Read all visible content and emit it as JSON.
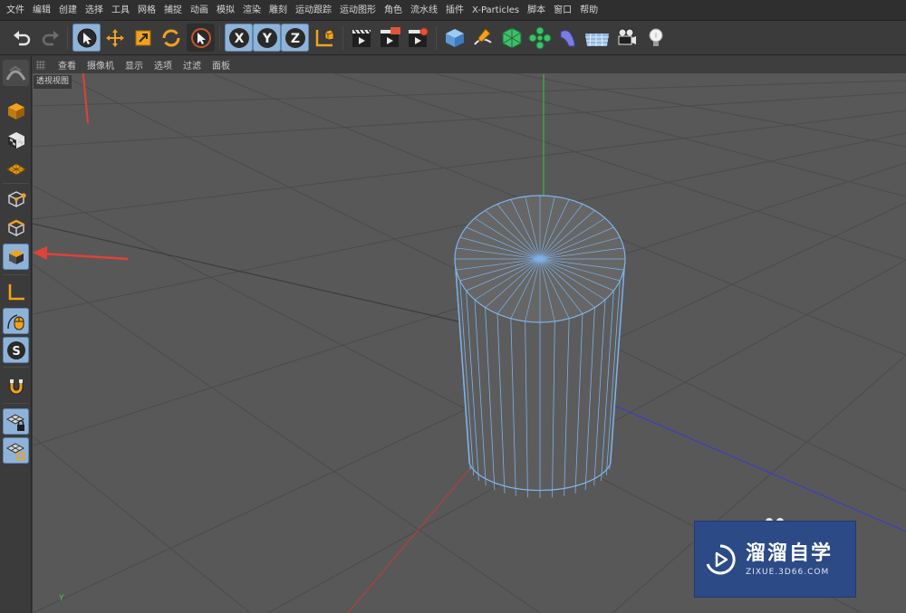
{
  "menubar": {
    "items": [
      "文件",
      "编辑",
      "创建",
      "选择",
      "工具",
      "网格",
      "捕捉",
      "动画",
      "模拟",
      "渲染",
      "雕刻",
      "运动跟踪",
      "运动图形",
      "角色",
      "流水线",
      "插件",
      "X-Particles",
      "脚本",
      "窗口",
      "帮助"
    ]
  },
  "toolbar": {
    "buttons": [
      "undo-icon",
      "redo-icon",
      "live-select-icon",
      "move-icon",
      "scale-icon",
      "rotate-icon",
      "recent-tool-icon",
      "x-axis-icon",
      "y-axis-icon",
      "z-axis-icon",
      "coordinate-system-icon",
      "render-view-icon",
      "render-picture-viewer-icon",
      "render-settings-icon",
      "cube-icon",
      "pen-spline-icon",
      "subdivision-icon",
      "mograph-cloner-icon",
      "deformer-icon",
      "floor-icon",
      "camera-icon",
      "light-icon"
    ],
    "axis_labels": {
      "x": "X",
      "y": "Y",
      "z": "Z"
    }
  },
  "leftbar": {
    "buttons": [
      "make-editable-icon",
      "texture-mode-icon",
      "workplane-icon",
      "points-mode-icon",
      "edges-mode-icon",
      "polygons-mode-icon",
      "enable-axis-icon",
      "tweak-mode-icon",
      "solo-icon",
      "snapping-icon",
      "workplane-lock-icon",
      "workplane-align-icon"
    ],
    "solo_label": "S"
  },
  "viewport": {
    "menu": [
      "查看",
      "摄像机",
      "显示",
      "选项",
      "过滤",
      "面板"
    ],
    "view_label": "透视视图",
    "axis_label": "Y",
    "object": "cylinder",
    "colors": {
      "background": "#585858",
      "grid": "#4a4a4a",
      "wire": "#7fb2e8",
      "y_axis": "#3cb53c",
      "x_axis": "#c43a3a",
      "z_axis": "#3a3ad0",
      "annotation_arrow": "#e0413a"
    }
  },
  "watermark": {
    "title": "溜溜自学",
    "url": "ZIXUE.3D66.COM",
    "color": "#2b4a86"
  }
}
